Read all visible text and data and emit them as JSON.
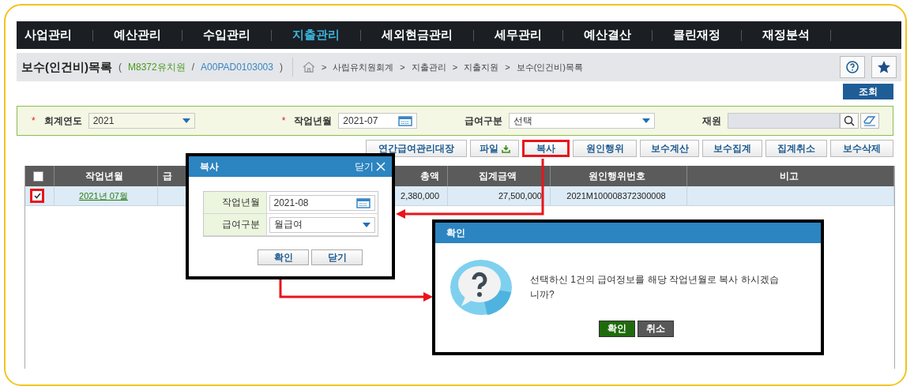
{
  "nav": {
    "items": [
      {
        "label": "사업관리",
        "selected": false
      },
      {
        "label": "예산관리",
        "selected": false
      },
      {
        "label": "수입관리",
        "selected": false
      },
      {
        "label": "지출관리",
        "selected": true
      },
      {
        "label": "세외현금관리",
        "selected": false
      },
      {
        "label": "세무관리",
        "selected": false
      },
      {
        "label": "예산결산",
        "selected": false
      },
      {
        "label": "클린재정",
        "selected": false
      },
      {
        "label": "재정분석",
        "selected": false
      }
    ]
  },
  "header": {
    "title": "보수(인건비)목록",
    "open_paren": "(",
    "org": "M8372유치원",
    "slash": "/",
    "code": "A00PAD0103003",
    "close_paren": ")",
    "separator": ">",
    "breadcrumb": [
      "사립유치원회계",
      "지출관리",
      "지출지원",
      "보수(인건비)목록"
    ]
  },
  "search_button": "조회",
  "filters": [
    {
      "kind": "select",
      "label": "회계연도",
      "mark": "*",
      "value": "2021"
    },
    {
      "kind": "date",
      "label": "작업년월",
      "mark": "*",
      "value": "2021-07"
    },
    {
      "kind": "select",
      "label": "급여구분",
      "value": "선택"
    },
    {
      "kind": "lookup",
      "label": "재원"
    }
  ],
  "actions": [
    {
      "label": "연간급여관리대장",
      "highlighted": false
    },
    {
      "label": "파일",
      "highlighted": false,
      "download": true
    },
    {
      "label": "복사",
      "highlighted": true
    },
    {
      "label": "원인행위",
      "highlighted": false
    },
    {
      "label": "보수계산",
      "highlighted": false
    },
    {
      "label": "보수집계",
      "highlighted": false
    },
    {
      "label": "집계취소",
      "highlighted": false
    },
    {
      "label": "보수삭제",
      "highlighted": false
    }
  ],
  "table": {
    "all_checked": false,
    "columns": [
      "작업년월",
      "급",
      "총액",
      "집계금액",
      "원인행위번호",
      "비고"
    ],
    "rows": [
      {
        "checked": true,
        "highlighted": true,
        "cells": [
          "2021년 07월",
          "",
          "2,380,000",
          "27,500,000",
          "2021M100008372300008",
          ""
        ]
      }
    ]
  },
  "copy_dialog": {
    "title": "복사",
    "close": "닫기",
    "fields": [
      {
        "kind": "date",
        "label": "작업년월",
        "value": "2021-08"
      },
      {
        "kind": "select",
        "label": "급여구분",
        "value": "월급여"
      }
    ],
    "buttons": [
      "확인",
      "닫기"
    ]
  },
  "confirm_dialog": {
    "title": "확인",
    "message": "선택하신 1건의 급여정보를 해당 작업년월로 복사 하시겠습니까?",
    "buttons": [
      {
        "kind": "primary",
        "label": "확인"
      },
      {
        "kind": "secondary",
        "label": "취소"
      }
    ]
  }
}
